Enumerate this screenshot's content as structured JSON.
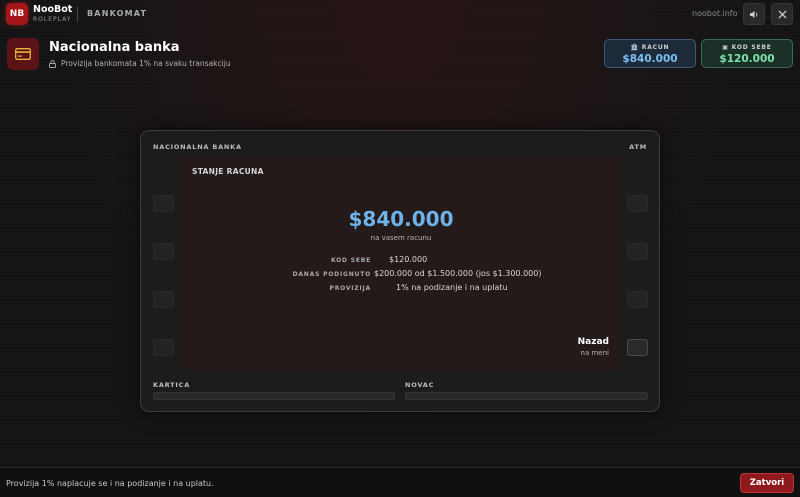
{
  "topbar": {
    "logo": "NB",
    "brand_name": "NooBot",
    "brand_sub": "ROLEPLAY",
    "section": "BANKOMAT",
    "site": "noobot.info",
    "sound_icon": "speaker-icon",
    "close_icon": "close-icon"
  },
  "header": {
    "icon": "credit-card-icon",
    "title": "Nacionalna banka",
    "subtitle_icon": "lock-icon",
    "subtitle": "Provizija bankomata 1% na svaku transakciju"
  },
  "balances": {
    "account": {
      "icon": "bank-icon",
      "label": "RACUN",
      "value": "$840.000"
    },
    "cash": {
      "icon": "wallet-icon",
      "label": "KOD SEBE",
      "value": "$120.000"
    }
  },
  "atm": {
    "label_left": "NACIONALNA BANKA",
    "label_right": "ATM",
    "screen": {
      "title": "STANJE RACUNA",
      "balance": "$840.000",
      "balance_sub": "na vasem racunu",
      "rows": [
        {
          "key": "KOD SEBE",
          "value": "$120.000"
        },
        {
          "key": "DANAS PODIGNUTO",
          "value": "$200.000 od $1.500.000 (jos $1.300.000)"
        },
        {
          "key": "PROVIZIJA",
          "value": "1% na podizanje i na uplatu"
        }
      ],
      "back_title": "Nazad",
      "back_sub": "na meni"
    },
    "slot_card_label": "KARTICA",
    "slot_cash_label": "NOVAC"
  },
  "footer": {
    "text": "Provizija 1% naplacuje se i na podizanje i na uplatu.",
    "close_label": "Zatvori"
  },
  "colors": {
    "accent_red": "#a5161a",
    "account_blue": "#6db3ea",
    "cash_green": "#7ee3ad"
  }
}
